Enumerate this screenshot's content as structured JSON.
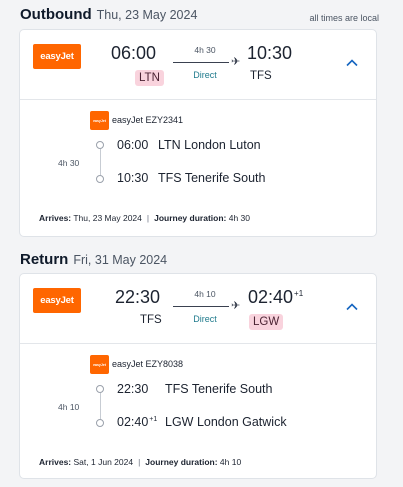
{
  "note": "all times are local",
  "outbound": {
    "title": "Outbound",
    "date": "Thu, 23 May 2024",
    "airline_logo": "easyJet",
    "dep_time": "06:00",
    "dep_code": "LTN",
    "arr_time": "10:30",
    "arr_code": "TFS",
    "arr_sup": "",
    "duration": "4h 30",
    "stops": "Direct",
    "flight": "easyJet EZY2341",
    "detail_duration": "4h 30",
    "dep_place": "LTN London Luton",
    "arr_place": "TFS Tenerife South",
    "arrives_label": "Arrives:",
    "arrives": "Thu, 23 May 2024",
    "journey_label": "Journey duration:",
    "journey": "4h 30"
  },
  "return": {
    "title": "Return",
    "date": "Fri, 31 May 2024",
    "airline_logo": "easyJet",
    "dep_time": "22:30",
    "dep_code": "TFS",
    "arr_time": "02:40",
    "arr_code": "LGW",
    "arr_sup": "+1",
    "duration": "4h 10",
    "stops": "Direct",
    "flight": "easyJet EZY8038",
    "detail_duration": "4h 10",
    "dep_place": "TFS Tenerife South",
    "arr_place": "LGW London Gatwick",
    "arrives_label": "Arrives:",
    "arrives": "Sat, 1 Jun 2024",
    "journey_label": "Journey duration:",
    "journey": "4h 10"
  },
  "icons": {
    "logo": "easyjet-logo-icon",
    "plane": "plane-icon",
    "collapse": "chevron-up-icon"
  },
  "colors": {
    "brand": "#ff6600",
    "highlight": "#f9d3dd",
    "direct": "#1f7a8c",
    "chevron": "#1565c0"
  }
}
